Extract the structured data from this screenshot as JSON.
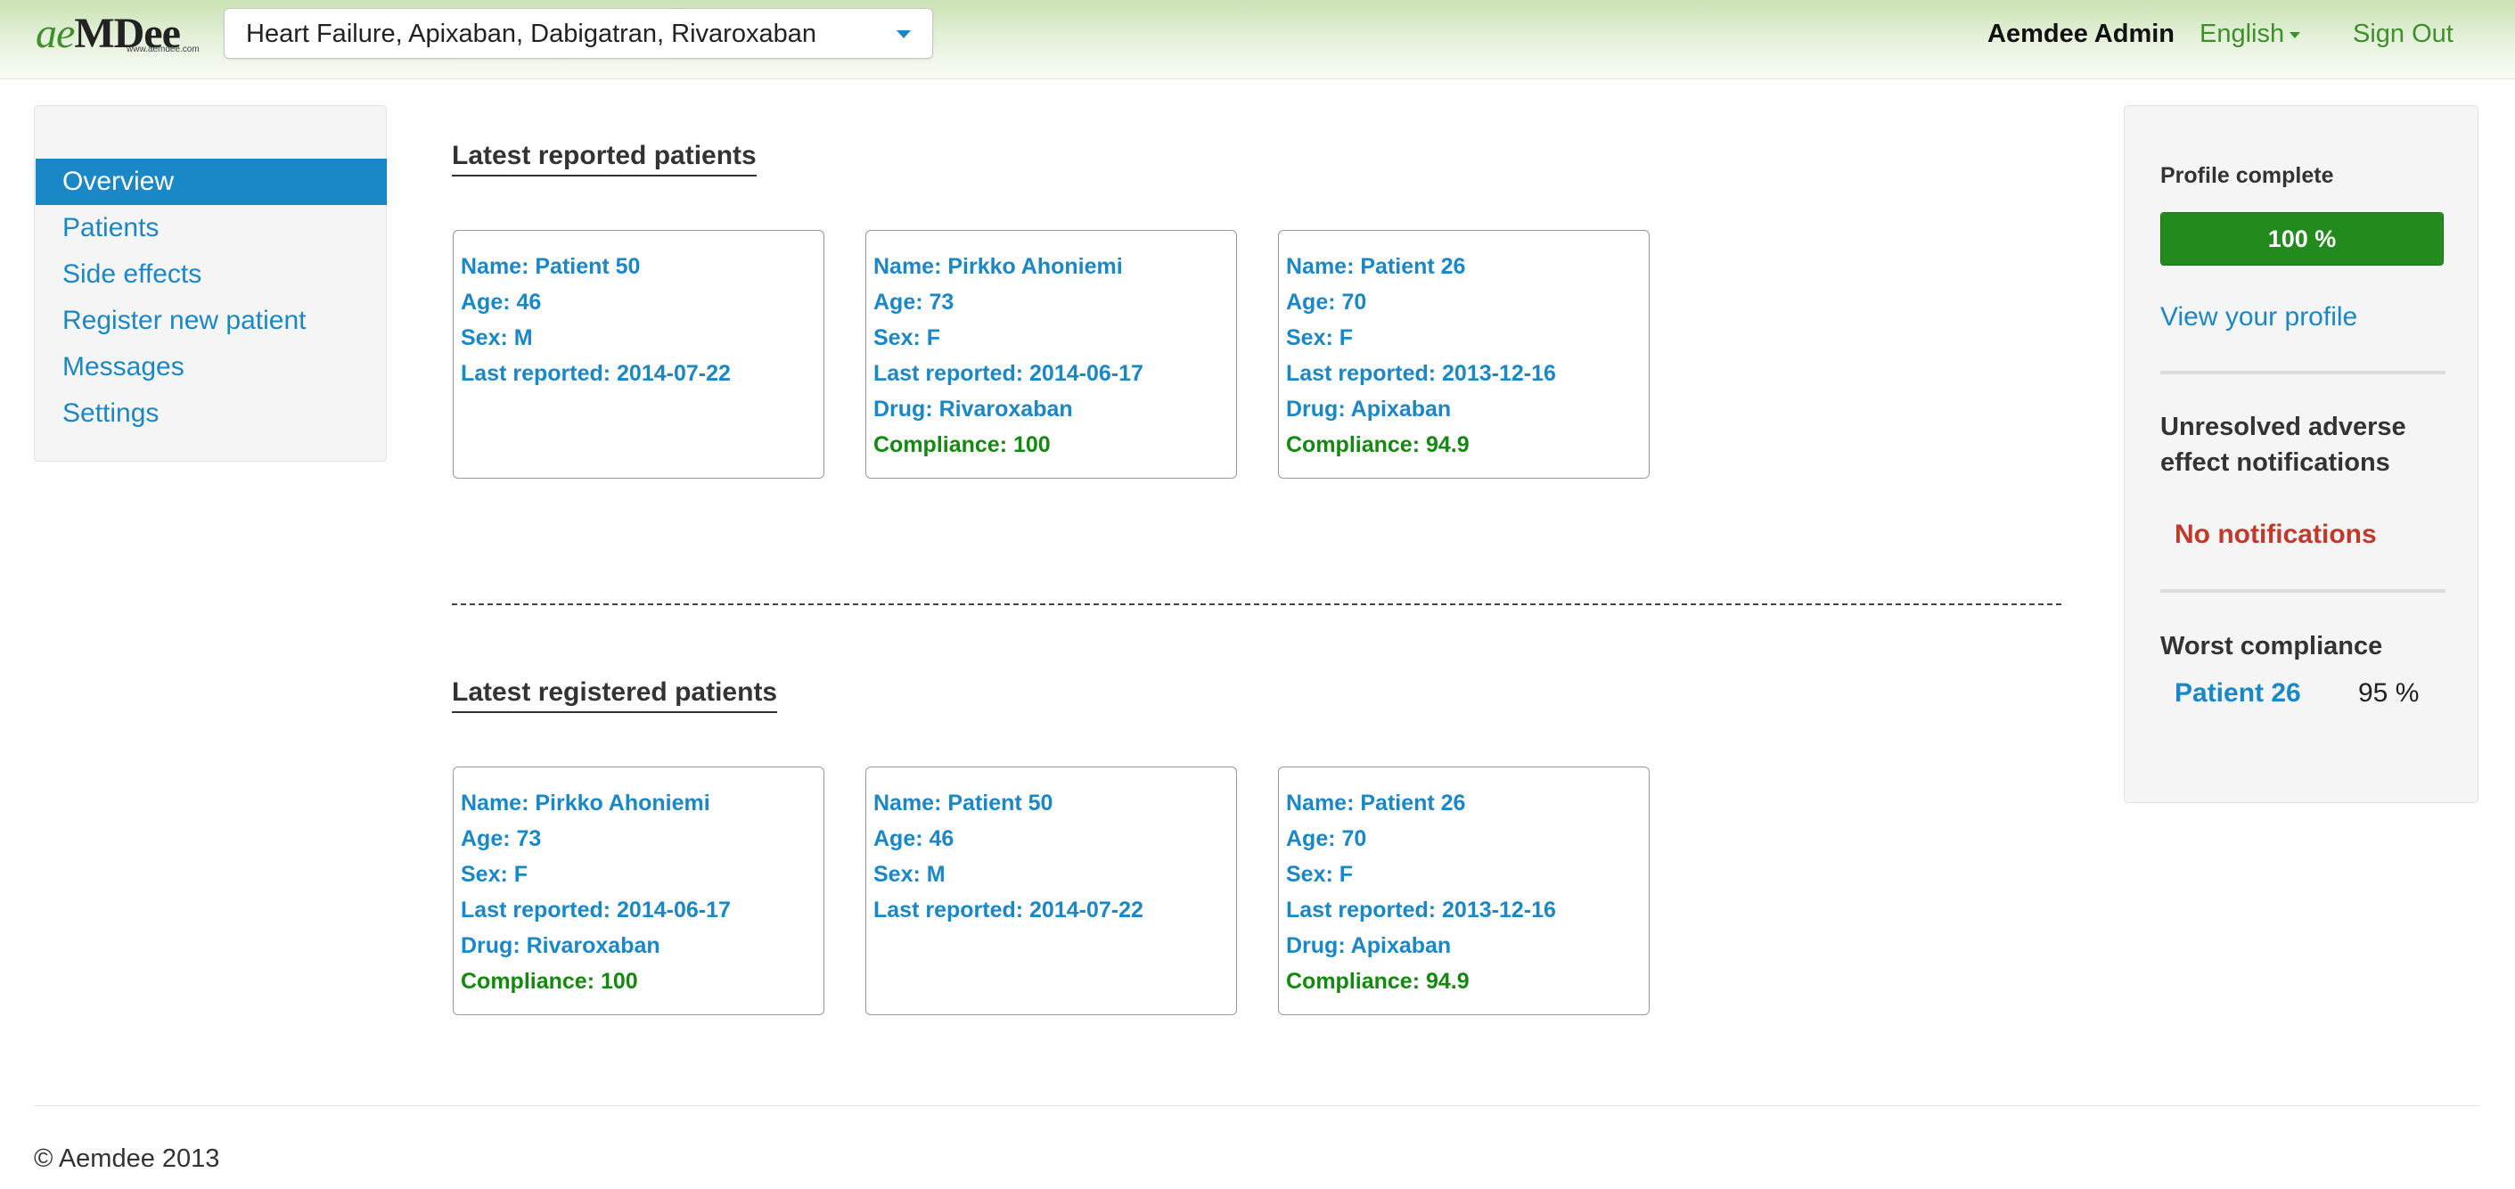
{
  "header": {
    "logo": {
      "ae": "ae",
      "md": "MDee",
      "url": "www.aemdee.com"
    },
    "indication_selector": {
      "value": "Heart Failure, Apixaban, Dabigatran, Rivaroxaban"
    },
    "user_name": "Aemdee Admin",
    "language": "English",
    "sign_out": "Sign Out"
  },
  "sidebar": {
    "items": [
      {
        "label": "Overview",
        "active": true
      },
      {
        "label": "Patients"
      },
      {
        "label": "Side effects"
      },
      {
        "label": "Register new patient"
      },
      {
        "label": "Messages"
      },
      {
        "label": "Settings"
      }
    ]
  },
  "main": {
    "reported": {
      "title": "Latest reported patients",
      "cards": [
        {
          "name": "Name: Patient 50",
          "age": "Age: 46",
          "sex": "Sex: M",
          "last_reported": "Last reported: 2014-07-22"
        },
        {
          "name": "Name: Pirkko Ahoniemi",
          "age": "Age: 73",
          "sex": "Sex: F",
          "last_reported": "Last reported: 2014-06-17",
          "drug": "Drug: Rivaroxaban",
          "compliance": "Compliance: 100"
        },
        {
          "name": "Name: Patient 26",
          "age": "Age: 70",
          "sex": "Sex: F",
          "last_reported": "Last reported: 2013-12-16",
          "drug": "Drug: Apixaban",
          "compliance": "Compliance: 94.9"
        }
      ]
    },
    "registered": {
      "title": "Latest registered patients",
      "cards": [
        {
          "name": "Name: Pirkko Ahoniemi",
          "age": "Age: 73",
          "sex": "Sex: F",
          "last_reported": "Last reported: 2014-06-17",
          "drug": "Drug: Rivaroxaban",
          "compliance": "Compliance: 100"
        },
        {
          "name": "Name: Patient 50",
          "age": "Age: 46",
          "sex": "Sex: M",
          "last_reported": "Last reported: 2014-07-22"
        },
        {
          "name": "Name: Patient 26",
          "age": "Age: 70",
          "sex": "Sex: F",
          "last_reported": "Last reported: 2013-12-16",
          "drug": "Drug: Apixaban",
          "compliance": "Compliance: 94.9"
        }
      ]
    }
  },
  "right_panel": {
    "profile_label": "Profile complete",
    "profile_progress": {
      "value_percent": 100,
      "text": "100 %"
    },
    "view_profile": "View your profile",
    "adverse_title": "Unresolved adverse effect notifications",
    "no_notifications": "No notifications",
    "worst_compliance_title": "Worst compliance",
    "worst_patient": "Patient 26",
    "worst_percent": "95 %"
  },
  "footer": {
    "copyright": "© Aemdee 2013"
  },
  "colors": {
    "link_blue": "#1a87c6",
    "brand_green": "#3f8f2b",
    "compliance_green": "#138a0f",
    "progress_green": "#238a1e",
    "alert_red": "#c0392b"
  }
}
